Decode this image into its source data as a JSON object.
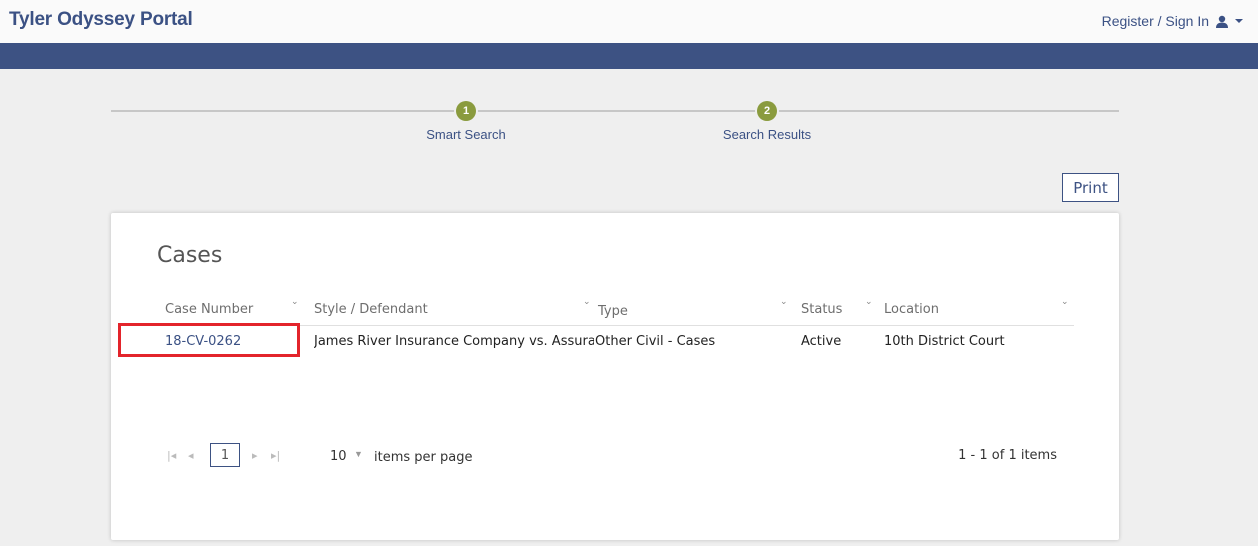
{
  "header": {
    "brand": "Tyler Odyssey Portal",
    "signin_label": "Register / Sign In",
    "user_icon": "user-icon",
    "caret_icon": "caret-down-icon"
  },
  "steps": [
    {
      "number": "1",
      "label": "Smart Search"
    },
    {
      "number": "2",
      "label": "Search Results"
    }
  ],
  "print_label": "Print",
  "cases": {
    "title": "Cases",
    "columns": [
      "Case Number",
      "Style / Defendant",
      "Type",
      "Status",
      "Location"
    ],
    "rows": [
      {
        "case_number": "18-CV-0262",
        "style": "James River Insurance Company vs. Assura",
        "type": "Other Civil - Cases",
        "status": "Active",
        "location": "10th District Court"
      }
    ],
    "pager": {
      "first": "⏮",
      "prev": "◀",
      "page": "1",
      "next": "▶",
      "last": "⏭",
      "page_size": "10",
      "items_per_page": "items per page",
      "count": "1 - 1 of 1 items"
    }
  },
  "colors": {
    "brand": "#3b5184",
    "bar": "#3d5283",
    "step": "#8a9b3e",
    "highlight": "#e3242b"
  }
}
